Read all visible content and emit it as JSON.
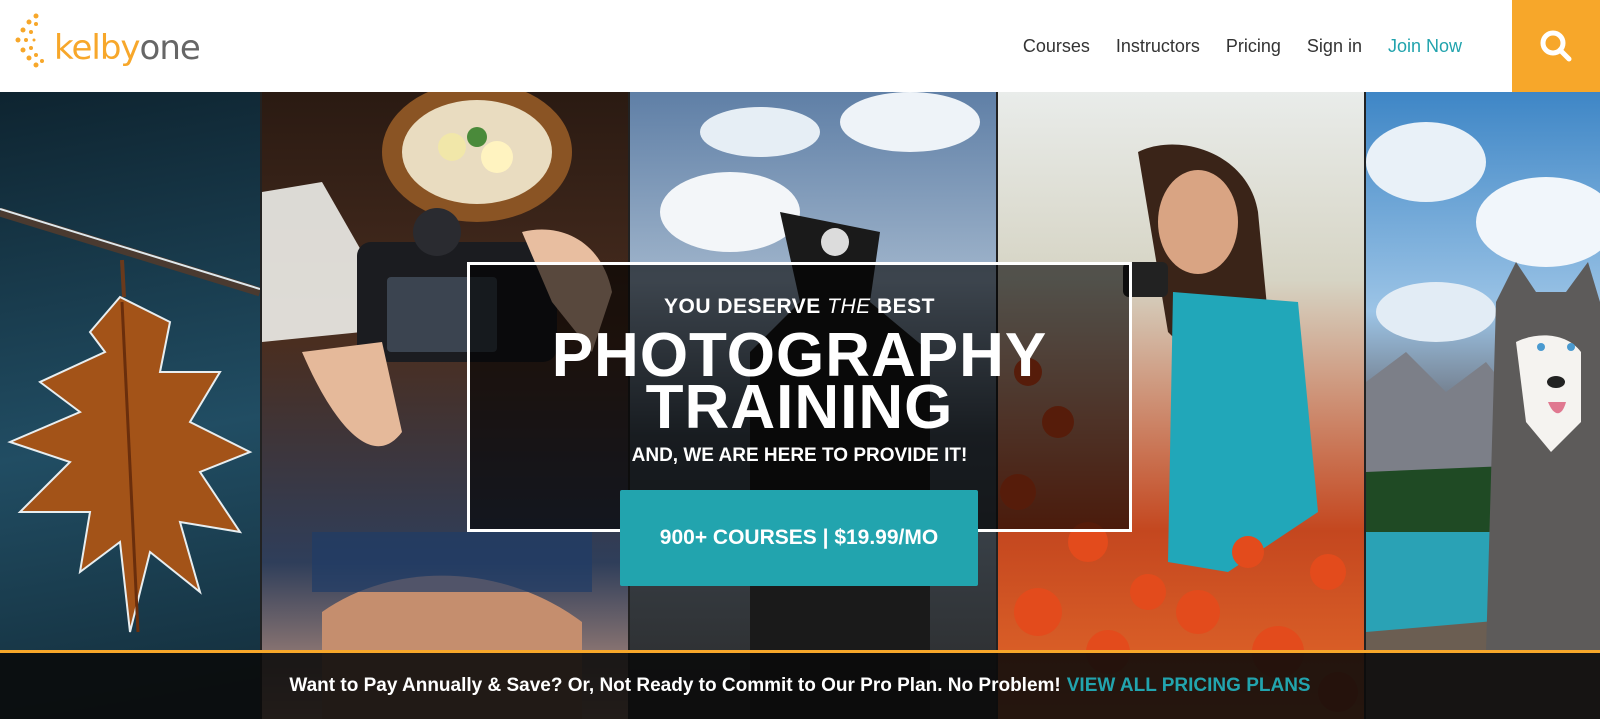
{
  "brand": {
    "logo_part1": "kelby",
    "logo_part2": "one",
    "accent": "#f7a72a",
    "teal": "#22a4ae"
  },
  "nav": {
    "items": [
      {
        "label": "Courses"
      },
      {
        "label": "Instructors"
      },
      {
        "label": "Pricing"
      },
      {
        "label": "Sign in"
      },
      {
        "label": "Join Now"
      }
    ],
    "search_icon": "search-icon"
  },
  "hero": {
    "tagline_prefix": "YOU DESERVE ",
    "tagline_em": "THE",
    "tagline_suffix": " BEST",
    "headline_line1": "PHOTOGRAPHY",
    "headline_line2": "TRAINING",
    "subtagline": "AND, WE ARE HERE TO PROVIDE IT!",
    "cta_label": "900+ COURSES | $19.99/MO"
  },
  "promo": {
    "text": "Want to Pay Annually & Save? Or, Not Ready to Commit to Our Pro Plan. No Problem!",
    "link": "VIEW ALL PRICING PLANS"
  }
}
